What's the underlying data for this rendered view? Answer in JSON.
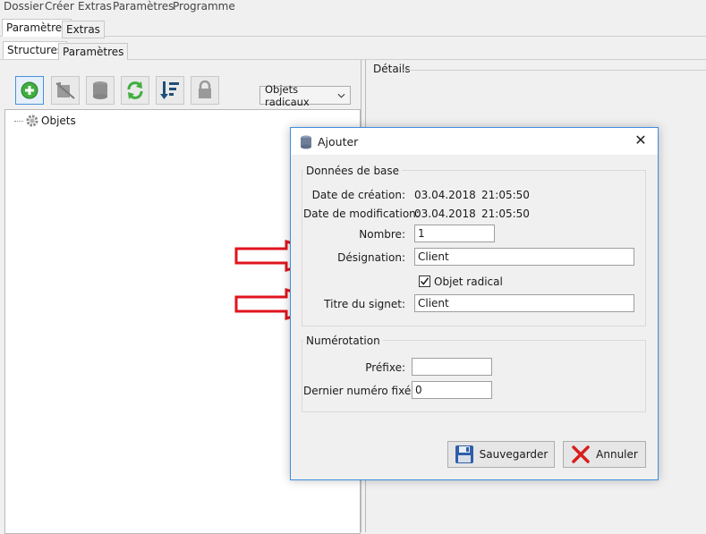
{
  "menu": [
    "Dossier",
    "Créer",
    "Extras",
    "Paramètres",
    "Programme"
  ],
  "top_tabs": [
    "Paramètres",
    "Extras"
  ],
  "sub_tabs": [
    "Structures",
    "Paramètres"
  ],
  "toolbar": {
    "icons": [
      "add-icon",
      "delete-icon",
      "database-icon",
      "refresh-icon",
      "sort-icon",
      "lock-icon"
    ],
    "dropdown_value": "Objets radicaux"
  },
  "tree": {
    "root_label": "Objets"
  },
  "details": {
    "label": "Détails"
  },
  "dialog": {
    "title": "Ajouter",
    "basic_group": "Données de base",
    "creation_label": "Date de création:",
    "creation_date": "03.04.2018",
    "creation_time": "21:05:50",
    "modification_label": "Date de modification:",
    "modification_date": "03.04.2018",
    "modification_time": "21:05:50",
    "number_label": "Nombre:",
    "number_value": "1",
    "designation_label": "Désignation:",
    "designation_value": "Client",
    "radical_label": "Objet radical",
    "radical_checked": true,
    "bookmark_label": "Titre du signet:",
    "bookmark_value": "Client",
    "numbering_group": "Numérotation",
    "prefix_label": "Préfixe:",
    "prefix_value": "",
    "last_number_label": "Dernier numéro fixé:",
    "last_number_value": "0",
    "save_label": "Sauvegarder",
    "cancel_label": "Annuler"
  },
  "colors": {
    "accent": "#3d8ee0",
    "arrow": "#e0141e"
  }
}
